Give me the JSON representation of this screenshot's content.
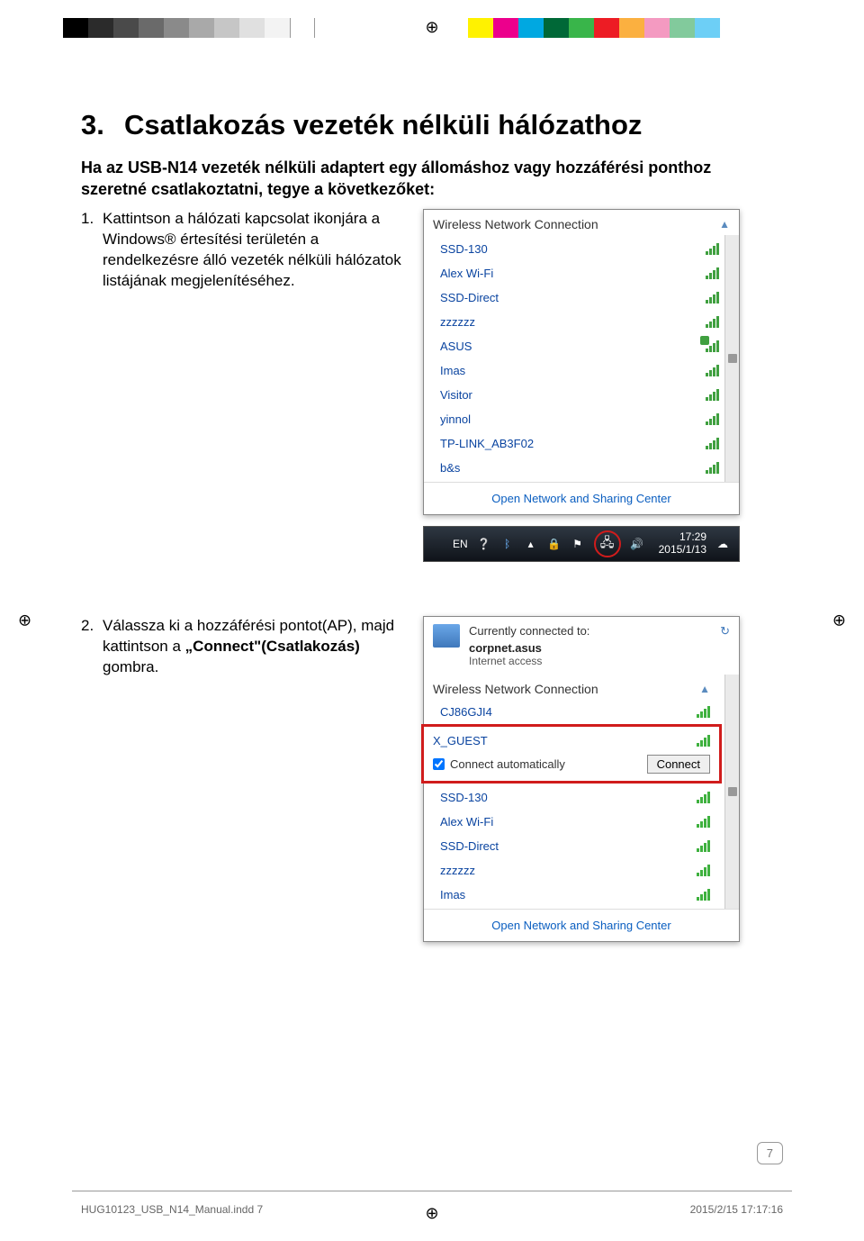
{
  "title": {
    "num": "3.",
    "text": "Csatlakozás vezeték nélküli hálózathoz"
  },
  "intro": "Ha az USB-N14 vezeték nélküli adaptert egy állomáshoz vagy hozzáférési ponthoz szeretné csatlakoztatni, tegye a következőket:",
  "step1": {
    "num": "1.",
    "text": "Kattintson a hálózati kapcsolat ikonjára a Windows® értesítési területén a rendelkezésre álló vezeték nélküli hálózatok listájának megjelenítéséhez."
  },
  "step2": {
    "num": "2.",
    "body_a": "Válassza ki a hozzáférési pontot(AP), majd kattintson a ",
    "body_b": "„Connect\"(Csatlakozás)",
    "body_c": " gombra."
  },
  "popup1": {
    "header": "Wireless Network Connection",
    "items": [
      "SSD-130",
      "Alex Wi-Fi",
      "SSD-Direct",
      "zzzzzz",
      "ASUS",
      "Imas",
      "Visitor",
      "yinnol",
      "TP-LINK_AB3F02",
      "b&s"
    ],
    "footer": "Open Network and Sharing Center"
  },
  "taskbar": {
    "lang": "EN",
    "time": "17:29",
    "date": "2015/1/13"
  },
  "popup2": {
    "currently": "Currently connected to:",
    "conn_name": "corpnet.asus",
    "conn_status": "Internet access",
    "header": "Wireless Network Connection",
    "first": "CJ86GJI4",
    "selected": "X_GUEST",
    "auto": "Connect automatically",
    "connect": "Connect",
    "rest": [
      "SSD-130",
      "Alex Wi-Fi",
      "SSD-Direct",
      "zzzzzz",
      "Imas"
    ],
    "footer": "Open Network and Sharing Center"
  },
  "page_num": "7",
  "footer_file": "HUG10123_USB_N14_Manual.indd   7",
  "footer_ts": "2015/2/15   17:17:16"
}
